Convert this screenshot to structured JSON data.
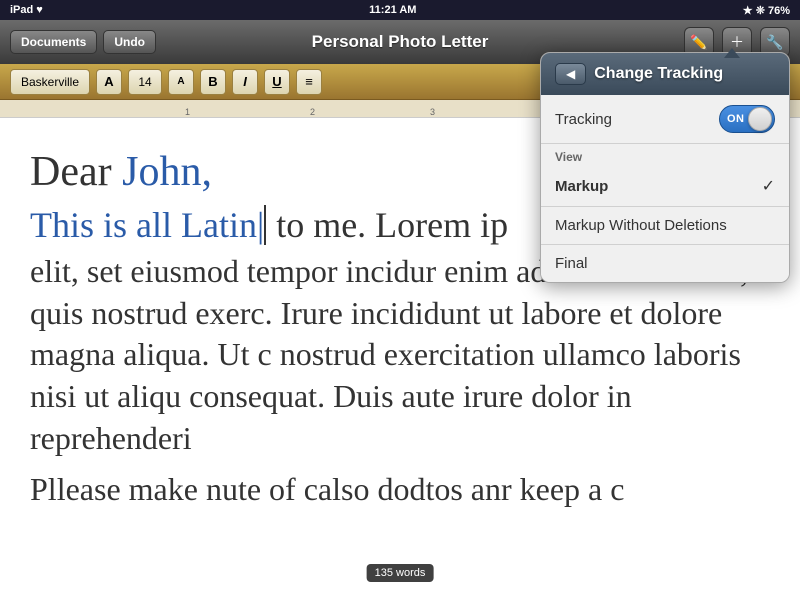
{
  "status_bar": {
    "left": "iPad ♥",
    "time": "11:21 AM",
    "right_icons": "★ ❊ 76%"
  },
  "toolbar": {
    "documents_btn": "Documents",
    "undo_btn": "Undo",
    "title": "Personal Photo Letter",
    "icon_brush": "🖌",
    "icon_plus": "+",
    "icon_wrench": "🔧"
  },
  "format_bar": {
    "font": "Baskerville",
    "size": "14",
    "format_a_label": "A",
    "bold_label": "B",
    "italic_label": "I",
    "underline_label": "U",
    "align_icon": "≡"
  },
  "document": {
    "line1_black": "Dear ",
    "line1_blue": "John,",
    "line2_blue": "This is all Latin",
    "line2_black": " to me. Lorem ip",
    "paragraph": "elit, set eiusmod tempor incidur enim ad minim veniam, quis nostrud exerc. Irure incididunt ut labore et dolore magna aliqua. Ut c nostrud exercitation ullamco laboris nisi ut aliqu consequat. Duis aute irure dolor in reprehenderi",
    "last_line": "Pllease make nute of calso dodtos anr keep a c",
    "word_count": "135 words"
  },
  "change_tracking": {
    "title": "Change Tracking",
    "back_btn": "◀",
    "tracking_label": "Tracking",
    "toggle_state": "ON",
    "view_section": "View",
    "option_markup": "Markup",
    "option_markup_without": "Markup Without Deletions",
    "option_final": "Final",
    "selected_option": "Markup"
  }
}
